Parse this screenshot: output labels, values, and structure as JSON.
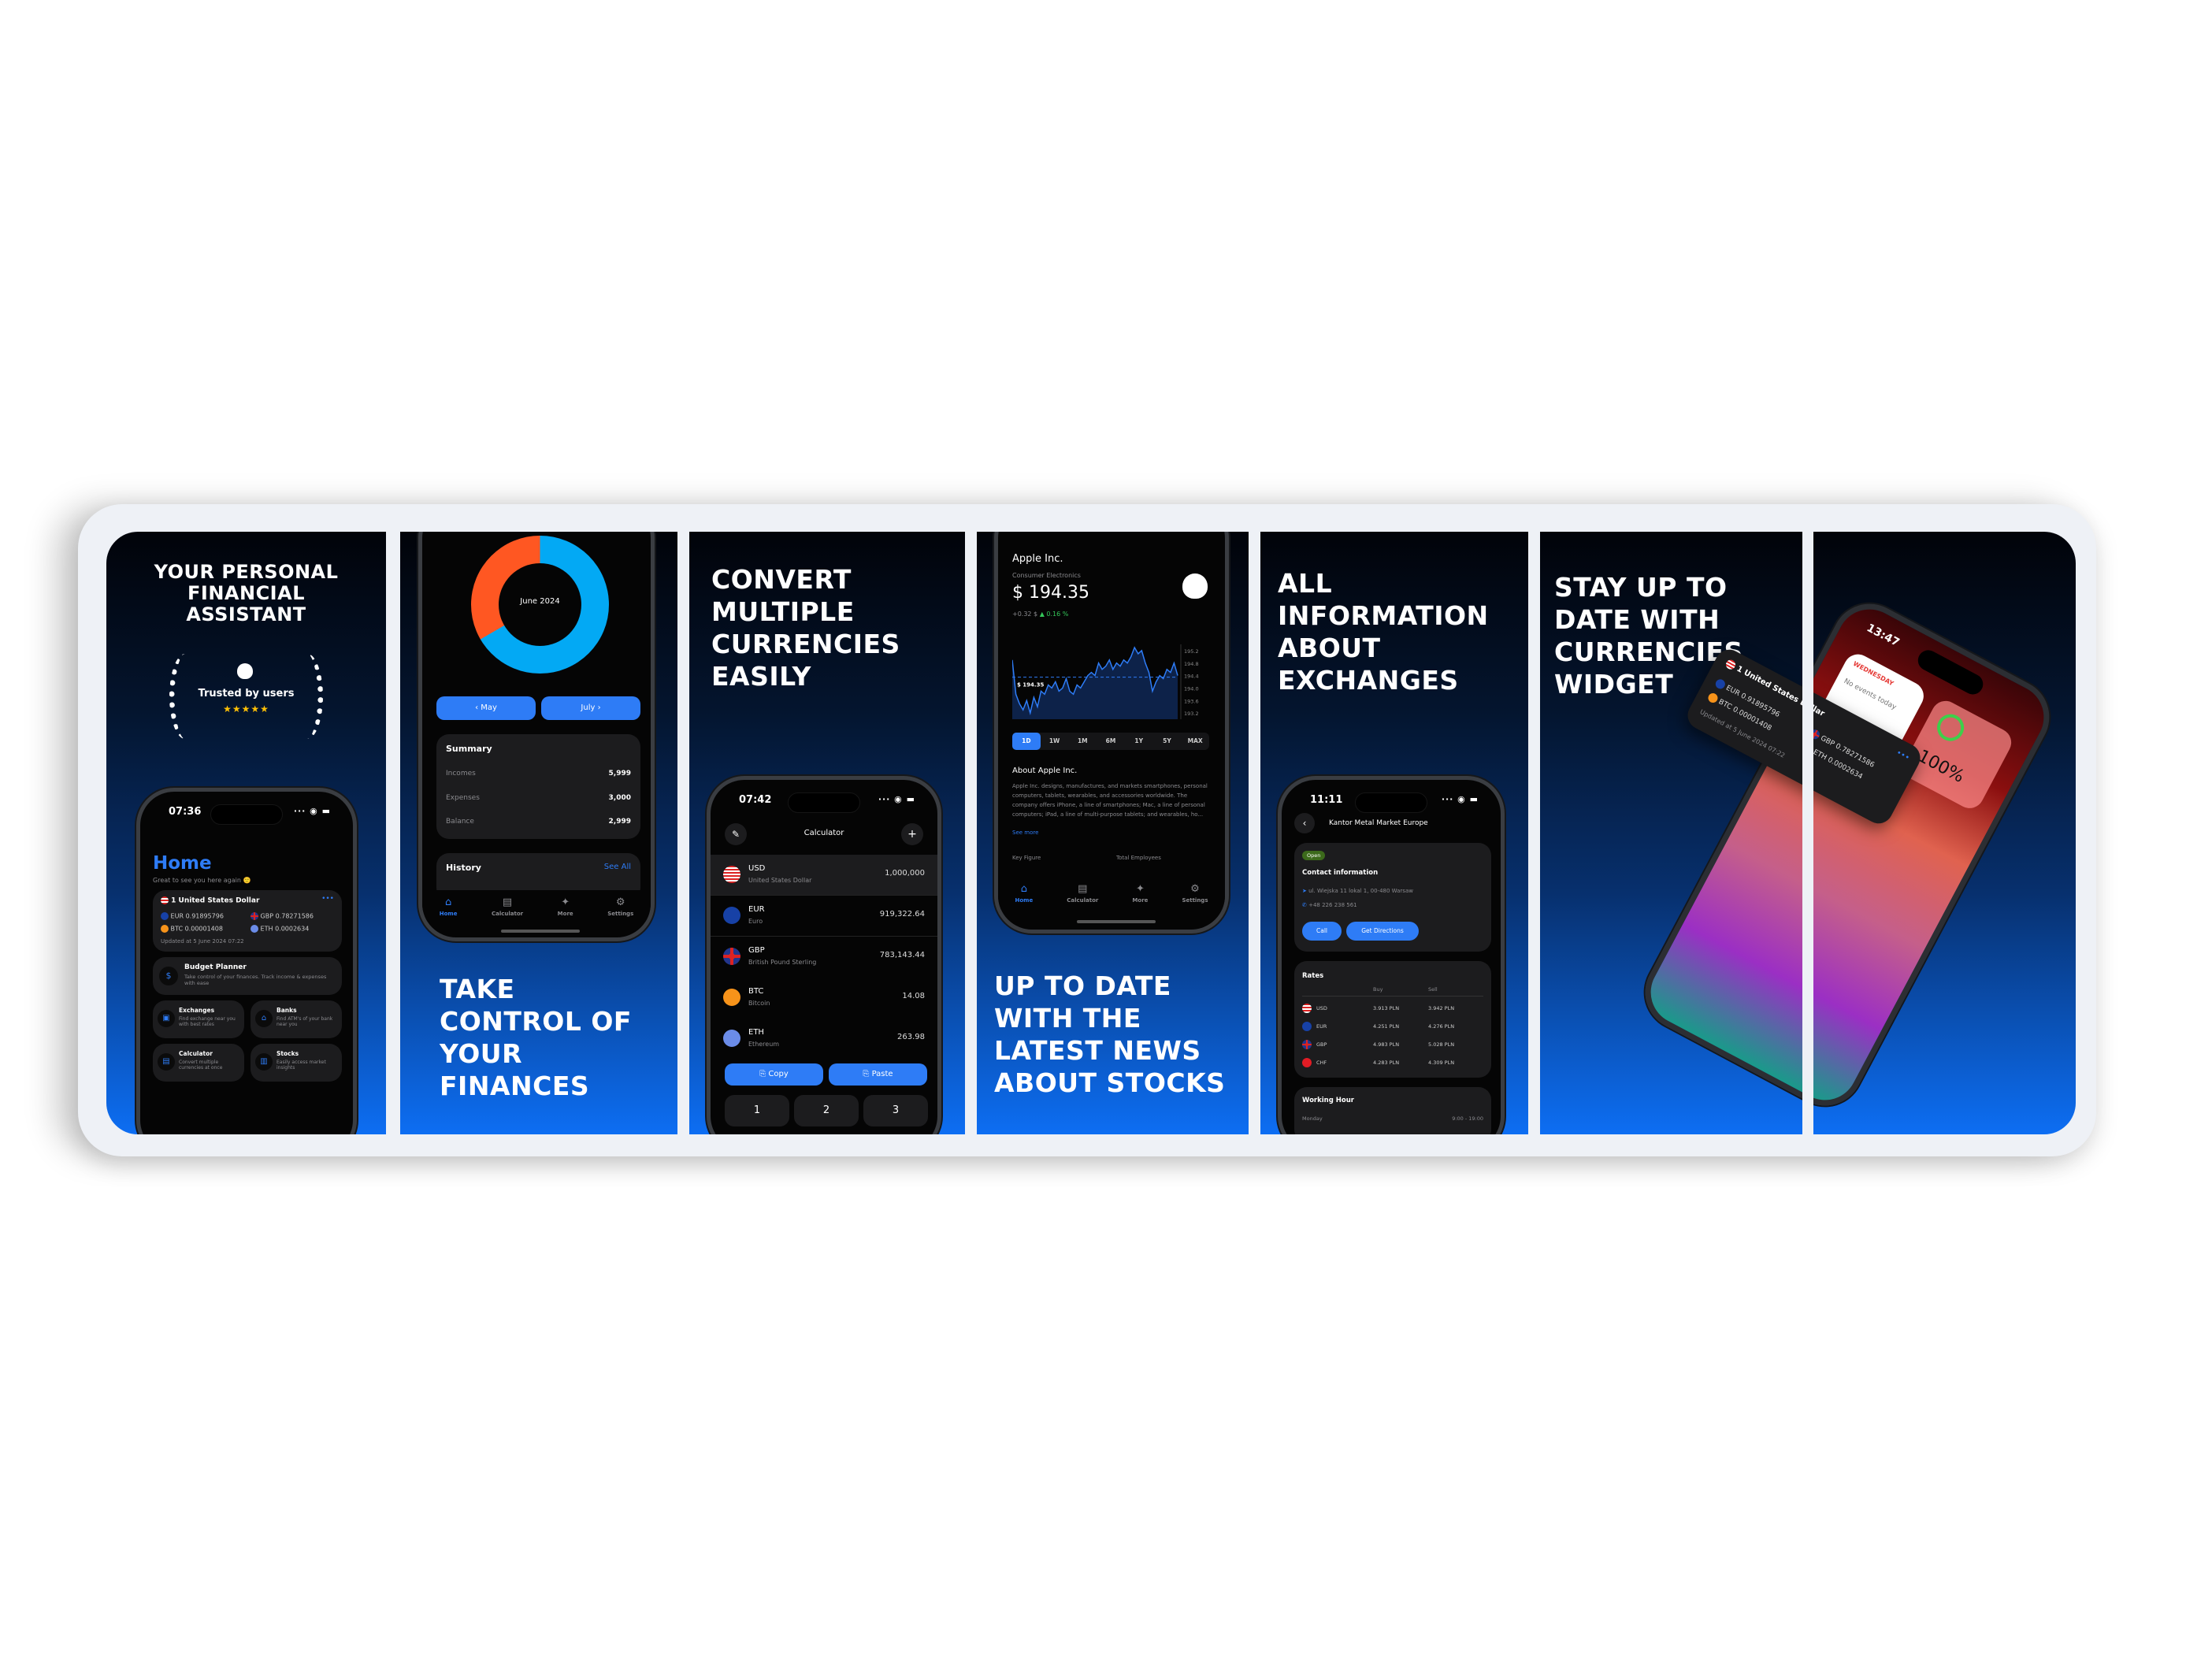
{
  "colors": {
    "accent": "#2e7cf6",
    "orange": "#ff5722",
    "cyan": "#03a9f4",
    "positive": "#34c759",
    "open_badge": "#3c6a1b"
  },
  "p1": {
    "heading": "YOUR PERSONAL FINANCIAL ASSISTANT",
    "badge": {
      "text": "Trusted by users",
      "stars": "★★★★★",
      "rating": 5,
      "icon": "apple-icon"
    },
    "time": "07:36",
    "title": "Home",
    "subtitle": "Great to see you here again 🙂",
    "widget": {
      "base": "1 United States Dollar",
      "more": "•••",
      "updated": "Updated at  5 June 2024 07:22",
      "rates": [
        {
          "code": "EUR",
          "value": "0.91895796"
        },
        {
          "code": "GBP",
          "value": "0.78271586"
        },
        {
          "code": "BTC",
          "value": "0.00001408"
        },
        {
          "code": "ETH",
          "value": "0.0002634"
        }
      ]
    },
    "features": [
      {
        "title": "Budget Planner",
        "desc": "Take control of your finances. Track income & expenses with ease",
        "icon": "dollar-icon"
      },
      {
        "title": "Exchanges",
        "desc": "Find exchange near you with best rates",
        "icon": "cash-icon"
      },
      {
        "title": "Banks",
        "desc": "Find ATM's of your bank near you",
        "icon": "bank-icon"
      },
      {
        "title": "Calculator",
        "desc": "Convert multiple currencies at once",
        "icon": "calculator-icon"
      },
      {
        "title": "Stocks",
        "desc": "Easily access market insights",
        "icon": "chart-icon"
      }
    ]
  },
  "p2": {
    "heading": "TAKE CONTROL OF YOUR FINANCES",
    "donut_center": "June 2024",
    "prev": "May",
    "next": "July",
    "summary": {
      "title": "Summary",
      "rows": [
        {
          "label": "Incomes",
          "value": "5,999"
        },
        {
          "label": "Expenses",
          "value": "3,000"
        },
        {
          "label": "Balance",
          "value": "2,999"
        }
      ]
    },
    "history": {
      "title": "History",
      "link": "See All"
    }
  },
  "tabs": [
    {
      "label": "Home",
      "icon": "home-icon"
    },
    {
      "label": "Calculator",
      "icon": "calculator-icon"
    },
    {
      "label": "More",
      "icon": "sparkle-icon"
    },
    {
      "label": "Settings",
      "icon": "gear-icon"
    }
  ],
  "p3": {
    "heading": "CONVERT MULTIPLE CURRENCIES EASILY",
    "time": "07:42",
    "title": "Calculator",
    "rows": [
      {
        "code": "USD",
        "name": "United States Dollar",
        "value": "1,000,000",
        "flag": "usd"
      },
      {
        "code": "EUR",
        "name": "Euro",
        "value": "919,322.64",
        "flag": "eur"
      },
      {
        "code": "GBP",
        "name": "British Pound Sterling",
        "value": "783,143.44",
        "flag": "gbp"
      },
      {
        "code": "BTC",
        "name": "Bitcoin",
        "value": "14.08",
        "flag": "btc"
      },
      {
        "code": "ETH",
        "name": "Ethereum",
        "value": "263.98",
        "flag": "eth"
      }
    ],
    "copy": "Copy",
    "paste": "Paste",
    "keys": [
      "1",
      "2",
      "3"
    ]
  },
  "p4": {
    "heading": "UP TO DATE WITH THE LATEST NEWS ABOUT STOCKS",
    "company": "Apple Inc.",
    "sector": "Consumer Electronics",
    "price": "$ 194.35",
    "change": "+0.32 $",
    "change_pct": "▲ 0.16 %",
    "ranges": [
      "1D",
      "1W",
      "1M",
      "6M",
      "1Y",
      "5Y",
      "MAX"
    ],
    "about_title": "About Apple Inc.",
    "about": "Apple Inc. designs, manufactures, and markets smartphones, personal computers, tablets, wearables, and accessories worldwide. The company offers iPhone, a line of smartphones; Mac, a line of personal computers; iPad, a line of multi-purpose tablets; and wearables, ho...",
    "see_more": "See more",
    "key_figure": "Key Figure",
    "employees": "Total Employees"
  },
  "chart_data": {
    "type": "line",
    "title": "",
    "price_label": "$ 194.35",
    "reference": 194.35,
    "yticks": [
      "195.2",
      "194.8",
      "194.4",
      "194.0",
      "193.6",
      "193.2"
    ],
    "ylim": [
      193.0,
      195.4
    ],
    "values": [
      194.9,
      193.8,
      193.5,
      193.3,
      193.6,
      193.2,
      193.7,
      193.4,
      193.9,
      193.8,
      194.1,
      194.0,
      194.2,
      193.9,
      194.0,
      194.3,
      193.9,
      193.8,
      194.1,
      194.0,
      194.2,
      194.4,
      194.5,
      194.4,
      194.8,
      194.6,
      194.7,
      194.9,
      194.6,
      194.8,
      194.7,
      194.9,
      194.8,
      195.0,
      195.3,
      195.1,
      195.2,
      194.8,
      194.5,
      193.9,
      194.2,
      194.4,
      194.3,
      194.6,
      194.5,
      194.8,
      194.4
    ],
    "selected_range": "1D"
  },
  "p5": {
    "heading": "ALL INFORMATION ABOUT EXCHANGES",
    "time": "11:11",
    "title": "Kantor Metal Market Europe",
    "status": "Open",
    "contact_title": "Contact information",
    "address": "ul. Wiejska 11 lokal 1, 00-480 Warsaw",
    "phone": "+48 226 238 561",
    "call": "Call",
    "directions": "Get Directions",
    "rates_title": "Rates",
    "buy": "Buy",
    "sell": "Sell",
    "rates": [
      {
        "code": "USD",
        "buy": "3.913 PLN",
        "sell": "3.942 PLN",
        "flag": "usd"
      },
      {
        "code": "EUR",
        "buy": "4.251 PLN",
        "sell": "4.276 PLN",
        "flag": "eur"
      },
      {
        "code": "GBP",
        "buy": "4.983 PLN",
        "sell": "5.028 PLN",
        "flag": "gbp"
      },
      {
        "code": "CHF",
        "buy": "4.283 PLN",
        "sell": "4.309 PLN",
        "flag": "chf"
      }
    ],
    "hours_title": "Working Hour",
    "day": "Monday",
    "hours": "9:00 - 19:00"
  },
  "p6": {
    "heading": "STAY UP TO DATE WITH CURRENCIES WIDGET",
    "time": "13:47",
    "calendar_day": "WEDNESDAY",
    "calendar_text": "No events today",
    "battery": "100%",
    "widget": {
      "base": "1 United States Dollar",
      "updated": "Updated at  5 June 2024 07:22",
      "rates": [
        {
          "code": "EUR",
          "value": "0.91895796"
        },
        {
          "code": "BTC",
          "value": "0.00001408"
        },
        {
          "code": "GBP",
          "value": "0.78271586"
        },
        {
          "code": "ETH",
          "value": "0.0002634"
        }
      ]
    }
  }
}
